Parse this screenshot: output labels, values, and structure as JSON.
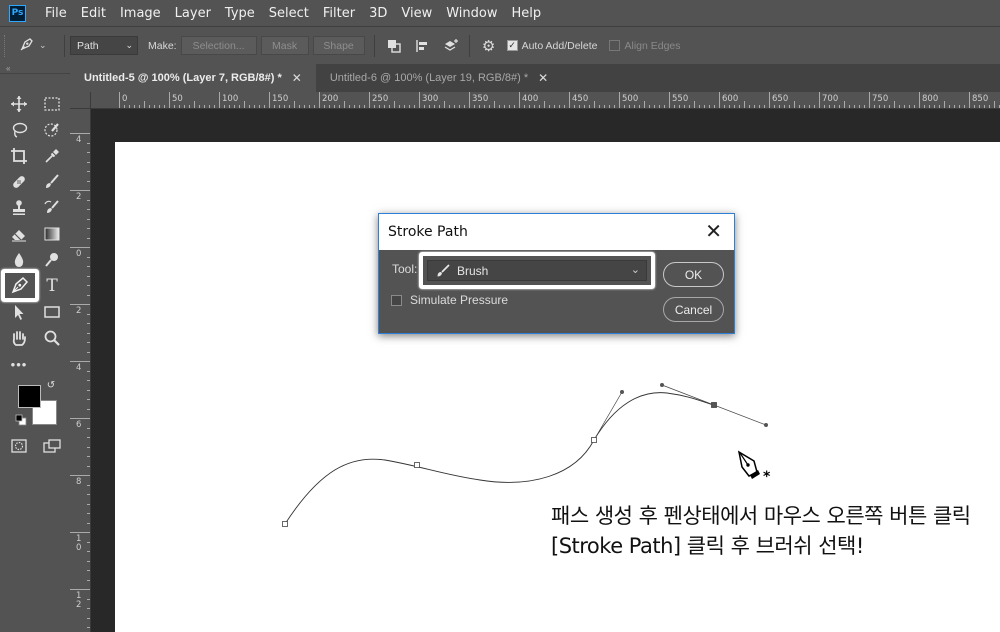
{
  "menubar": {
    "logo": "Ps",
    "items": [
      "File",
      "Edit",
      "Image",
      "Layer",
      "Type",
      "Select",
      "Filter",
      "3D",
      "View",
      "Window",
      "Help"
    ]
  },
  "options_bar": {
    "mode_value": "Path",
    "make_label": "Make:",
    "selection_label": "Selection...",
    "mask_label": "Mask",
    "shape_label": "Shape",
    "auto_add_delete_label": "Auto Add/Delete",
    "auto_add_delete_checked": true,
    "align_edges_label": "Align Edges",
    "align_edges_checked": false
  },
  "tabs": [
    {
      "label": "Untitled-5 @ 100% (Layer 7, RGB/8#) *",
      "active": true
    },
    {
      "label": "Untitled-6 @ 100% (Layer 19, RGB/8#) *",
      "active": false
    }
  ],
  "ruler_top_labels": [
    "0",
    "50",
    "100",
    "150",
    "200",
    "250",
    "300",
    "350",
    "400",
    "450",
    "500",
    "550",
    "600",
    "650",
    "700",
    "750",
    "800",
    "850"
  ],
  "ruler_left_labels": [
    "4",
    "2",
    "0",
    "2",
    "4",
    "6",
    "8",
    "10",
    "12"
  ],
  "dialog": {
    "title": "Stroke Path",
    "tool_label": "Tool:",
    "tool_value": "Brush",
    "simulate_pressure_label": "Simulate Pressure",
    "simulate_pressure_checked": false,
    "ok_label": "OK",
    "cancel_label": "Cancel"
  },
  "caption": {
    "line1": "패스 생성 후 펜상태에서 마우스 오른쪽 버튼 클릭",
    "line2": "[Stroke Path] 클릭 후 브러쉬 선택!"
  },
  "colors": {
    "foreground": "#000000",
    "background": "#ffffff",
    "dialog_accent": "#2e7fd6"
  }
}
